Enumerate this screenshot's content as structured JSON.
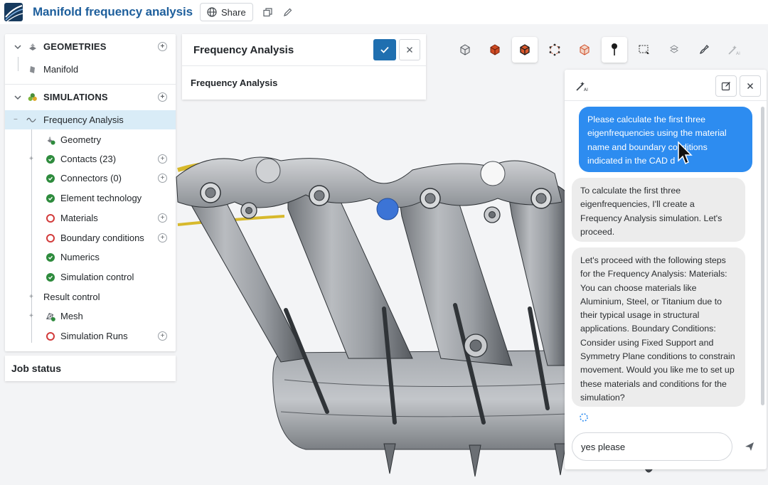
{
  "header": {
    "title": "Manifold frequency analysis",
    "share_label": "Share"
  },
  "tree": {
    "geometries_label": "GEOMETRIES",
    "geometry_item": "Manifold",
    "simulations_label": "SIMULATIONS",
    "simulation_item": "Frequency Analysis",
    "children": [
      {
        "label": "Geometry",
        "status": "geometry"
      },
      {
        "label": "Contacts (23)",
        "status": "ok"
      },
      {
        "label": "Connectors (0)",
        "status": "ok"
      },
      {
        "label": "Element technology",
        "status": "ok"
      },
      {
        "label": "Materials",
        "status": "error"
      },
      {
        "label": "Boundary conditions",
        "status": "error"
      },
      {
        "label": "Numerics",
        "status": "ok"
      },
      {
        "label": "Simulation control",
        "status": "ok"
      },
      {
        "label": "Result control",
        "status": "none"
      },
      {
        "label": "Mesh",
        "status": "mesh"
      },
      {
        "label": "Simulation Runs",
        "status": "error"
      }
    ]
  },
  "job_status": {
    "label": "Job status"
  },
  "fa_card": {
    "title": "Frequency Analysis",
    "subtitle": "Frequency Analysis"
  },
  "toolbar": {
    "icons": [
      "cube-outline-icon",
      "cube-solid-icon",
      "cube-edges-icon",
      "cube-vertices-icon",
      "cube-faces-icon",
      "pin-icon",
      "box-select-icon",
      "assembly-icon",
      "paint-icon",
      "ai-wand-icon"
    ]
  },
  "chat": {
    "user_message": "Please calculate the first three eigenfrequencies using the material name and boundary conditions indicated in the CAD data",
    "user_message_visible": "Please calculate the first three eigenfrequencies using the material name and boundary co ditions indicated in the CAD d ",
    "bot_message_1": "To calculate the first three eigenfrequencies, I'll create a Frequency Analysis simulation. Let's proceed.",
    "bot_message_2": "Let's proceed with the following steps for the Frequency Analysis: Materials: You can choose materials like Aluminium, Steel, or Titanium due to their typical usage in structural applications. Boundary Conditions: Consider using Fixed Support and Symmetry Plane conditions to constrain movement. Would you like me to set up these materials and conditions for the simulation?",
    "input_value": "yes please"
  },
  "colors": {
    "brand_blue": "#1e5f9c",
    "accent_blue": "#1f6fb0",
    "user_bubble": "#2d8cf0",
    "ok_green": "#2e8b3d",
    "error_red": "#d23b3b",
    "selected_row": "#d9ecf7"
  }
}
